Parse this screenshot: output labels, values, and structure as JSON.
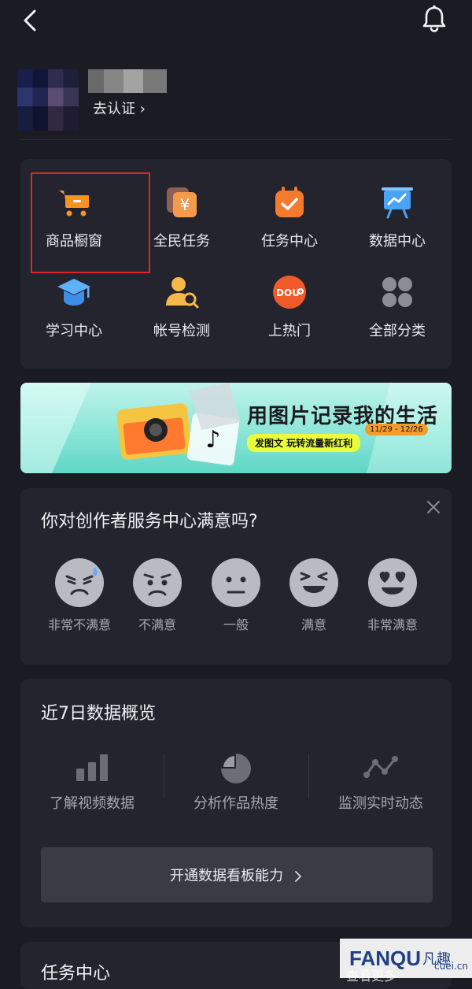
{
  "profile": {
    "verify_label": "去认证 ›"
  },
  "tools": [
    {
      "label": "商品橱窗",
      "icon": "shopping-cart-icon",
      "color": "#f7931e"
    },
    {
      "label": "全民任务",
      "icon": "coin-yen-icon",
      "color": "#f39a4b"
    },
    {
      "label": "任务中心",
      "icon": "calendar-check-icon",
      "color": "#f47a2d"
    },
    {
      "label": "数据中心",
      "icon": "presentation-chart-icon",
      "color": "#4aa3f5"
    },
    {
      "label": "学习中心",
      "icon": "graduation-cap-icon",
      "color": "#4aa3f5"
    },
    {
      "label": "帐号检测",
      "icon": "user-search-icon",
      "color": "#f6b84a"
    },
    {
      "label": "上热门",
      "icon": "dou-plus-icon",
      "color": "#f05a2a"
    },
    {
      "label": "全部分类",
      "icon": "grid-icon",
      "color": "#8b8c96"
    }
  ],
  "banner": {
    "title": "用图片记录我的生活",
    "dates": "11/29 - 12/26",
    "subtitle": "发图文 玩转流量新红利"
  },
  "survey": {
    "title": "你对创作者服务中心满意吗?",
    "options": [
      {
        "label": "非常不满意",
        "icon": "very-dissatisfied-face-icon"
      },
      {
        "label": "不满意",
        "icon": "dissatisfied-face-icon"
      },
      {
        "label": "一般",
        "icon": "neutral-face-icon"
      },
      {
        "label": "满意",
        "icon": "satisfied-face-icon"
      },
      {
        "label": "非常满意",
        "icon": "very-satisfied-face-icon"
      }
    ]
  },
  "stats": {
    "title": "近7日数据概览",
    "items": [
      {
        "label": "了解视频数据",
        "icon": "bar-chart-icon"
      },
      {
        "label": "分析作品热度",
        "icon": "pie-chart-icon"
      },
      {
        "label": "监测实时动态",
        "icon": "line-trend-icon"
      }
    ],
    "button_label": "开通数据看板能力"
  },
  "task": {
    "title": "任务中心",
    "more_label": "查看更多"
  },
  "watermark": {
    "brand": "FANQU",
    "brand_cn": "凡趣",
    "site": "cuei.cn"
  }
}
